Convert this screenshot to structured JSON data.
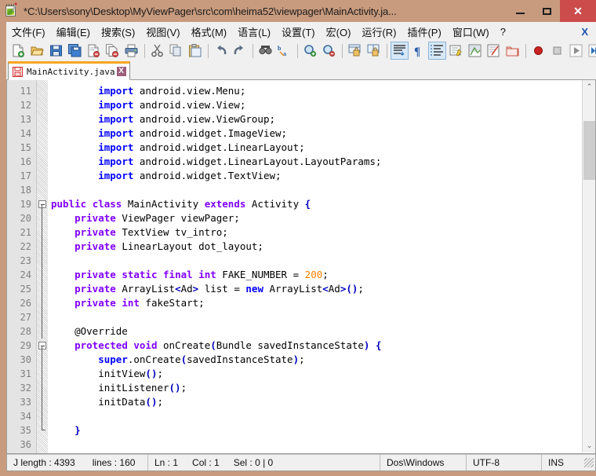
{
  "window": {
    "title": "*C:\\Users\\sony\\Desktop\\MyViewPager\\src\\com\\heima52\\viewpager\\MainActivity.ja...",
    "app_icon": "notepadpp-icon",
    "controls": {
      "minimize": "–",
      "maximize": "□",
      "close": "✕"
    }
  },
  "menubar": {
    "items": [
      {
        "label": "文件(F)"
      },
      {
        "label": "编辑(E)"
      },
      {
        "label": "搜索(S)"
      },
      {
        "label": "视图(V)"
      },
      {
        "label": "格式(M)"
      },
      {
        "label": "语言(L)"
      },
      {
        "label": "设置(T)"
      },
      {
        "label": "宏(O)"
      },
      {
        "label": "运行(R)"
      },
      {
        "label": "插件(P)"
      },
      {
        "label": "窗口(W)"
      },
      {
        "label": "?"
      }
    ],
    "close_document": "X"
  },
  "toolbar": {
    "buttons": [
      {
        "name": "new-file-icon",
        "tip": "新建"
      },
      {
        "name": "open-file-icon",
        "tip": "打开"
      },
      {
        "name": "save-icon",
        "tip": "保存"
      },
      {
        "name": "save-all-icon",
        "tip": "全部保存"
      },
      {
        "name": "close-file-icon",
        "tip": "关闭"
      },
      {
        "name": "close-all-files-icon",
        "tip": "全部关闭"
      },
      {
        "name": "print-icon",
        "tip": "打印"
      },
      {
        "name": "cut-icon",
        "tip": "剪切"
      },
      {
        "name": "copy-icon",
        "tip": "复制"
      },
      {
        "name": "paste-icon",
        "tip": "粘贴"
      },
      {
        "name": "undo-icon",
        "tip": "撤销"
      },
      {
        "name": "redo-icon",
        "tip": "重做"
      },
      {
        "name": "find-icon",
        "tip": "查找"
      },
      {
        "name": "replace-icon",
        "tip": "替换"
      },
      {
        "name": "zoom-in-icon",
        "tip": "放大"
      },
      {
        "name": "zoom-out-icon",
        "tip": "缩小"
      },
      {
        "name": "sync-vertical-icon",
        "tip": "同步垂直滚动"
      },
      {
        "name": "sync-horizontal-icon",
        "tip": "同步水平滚动"
      },
      {
        "name": "word-wrap-icon",
        "tip": "自动换行"
      },
      {
        "name": "show-all-chars-icon",
        "tip": "显示所有字符"
      },
      {
        "name": "indent-guide-icon",
        "tip": "显示缩进对齐线"
      },
      {
        "name": "user-language-icon",
        "tip": "用户自定义语言"
      },
      {
        "name": "doc-map-icon",
        "tip": "文档映射"
      },
      {
        "name": "function-list-icon",
        "tip": "函数列表"
      },
      {
        "name": "folder-workspace-icon",
        "tip": "文件夹"
      },
      {
        "name": "macro-record-icon",
        "tip": "开始录制"
      },
      {
        "name": "macro-stop-icon",
        "tip": "停止录制"
      },
      {
        "name": "macro-play-icon",
        "tip": "回放"
      },
      {
        "name": "macro-runmulti-icon",
        "tip": "多次运行"
      }
    ],
    "selected": [
      "word-wrap-icon",
      "indent-guide-icon"
    ]
  },
  "tabs": [
    {
      "label": "MainActivity.java",
      "icon": "red-save-icon",
      "close": "X",
      "active": true
    }
  ],
  "editor": {
    "first_line": 11,
    "lines": [
      {
        "n": 11,
        "fold": "none",
        "tokens": [
          {
            "t": "        ",
            "c": "pl"
          },
          {
            "t": "import",
            "c": "kw2"
          },
          {
            "t": " android.view.Menu;",
            "c": "pl"
          }
        ]
      },
      {
        "n": 12,
        "fold": "none",
        "tokens": [
          {
            "t": "        ",
            "c": "pl"
          },
          {
            "t": "import",
            "c": "kw2"
          },
          {
            "t": " android.view.View;",
            "c": "pl"
          }
        ]
      },
      {
        "n": 13,
        "fold": "none",
        "tokens": [
          {
            "t": "        ",
            "c": "pl"
          },
          {
            "t": "import",
            "c": "kw2"
          },
          {
            "t": " android.view.ViewGroup;",
            "c": "pl"
          }
        ]
      },
      {
        "n": 14,
        "fold": "none",
        "tokens": [
          {
            "t": "        ",
            "c": "pl"
          },
          {
            "t": "import",
            "c": "kw2"
          },
          {
            "t": " android.widget.ImageView;",
            "c": "pl"
          }
        ]
      },
      {
        "n": 15,
        "fold": "none",
        "tokens": [
          {
            "t": "        ",
            "c": "pl"
          },
          {
            "t": "import",
            "c": "kw2"
          },
          {
            "t": " android.widget.LinearLayout;",
            "c": "pl"
          }
        ]
      },
      {
        "n": 16,
        "fold": "none",
        "tokens": [
          {
            "t": "        ",
            "c": "pl"
          },
          {
            "t": "import",
            "c": "kw2"
          },
          {
            "t": " android.widget.LinearLayout.LayoutParams;",
            "c": "pl"
          }
        ]
      },
      {
        "n": 17,
        "fold": "none",
        "tokens": [
          {
            "t": "        ",
            "c": "pl"
          },
          {
            "t": "import",
            "c": "kw2"
          },
          {
            "t": " android.widget.TextView;",
            "c": "pl"
          }
        ]
      },
      {
        "n": 18,
        "fold": "none",
        "tokens": []
      },
      {
        "n": 19,
        "fold": "open",
        "tokens": [
          {
            "t": "",
            "c": "pl"
          },
          {
            "t": "public",
            "c": "kw"
          },
          {
            "t": " ",
            "c": "pl"
          },
          {
            "t": "class",
            "c": "kw"
          },
          {
            "t": " MainActivity ",
            "c": "pl"
          },
          {
            "t": "extends",
            "c": "kw"
          },
          {
            "t": " Activity ",
            "c": "pl"
          },
          {
            "t": "{",
            "c": "op"
          }
        ]
      },
      {
        "n": 20,
        "fold": "line",
        "tokens": [
          {
            "t": "    ",
            "c": "pl"
          },
          {
            "t": "private",
            "c": "kw"
          },
          {
            "t": " ViewPager viewPager;",
            "c": "pl"
          }
        ]
      },
      {
        "n": 21,
        "fold": "line",
        "tokens": [
          {
            "t": "    ",
            "c": "pl"
          },
          {
            "t": "private",
            "c": "kw"
          },
          {
            "t": " TextView tv_intro;",
            "c": "pl"
          }
        ]
      },
      {
        "n": 22,
        "fold": "line",
        "tokens": [
          {
            "t": "    ",
            "c": "pl"
          },
          {
            "t": "private",
            "c": "kw"
          },
          {
            "t": " LinearLayout dot_layout;",
            "c": "pl"
          }
        ]
      },
      {
        "n": 23,
        "fold": "line",
        "tokens": []
      },
      {
        "n": 24,
        "fold": "line",
        "tokens": [
          {
            "t": "    ",
            "c": "pl"
          },
          {
            "t": "private",
            "c": "kw"
          },
          {
            "t": " ",
            "c": "pl"
          },
          {
            "t": "static",
            "c": "kw"
          },
          {
            "t": " ",
            "c": "pl"
          },
          {
            "t": "final",
            "c": "kw"
          },
          {
            "t": " ",
            "c": "pl"
          },
          {
            "t": "int",
            "c": "kw"
          },
          {
            "t": " FAKE_NUMBER ",
            "c": "pl"
          },
          {
            "t": "=",
            "c": "pl"
          },
          {
            "t": " ",
            "c": "pl"
          },
          {
            "t": "200",
            "c": "num"
          },
          {
            "t": ";",
            "c": "pl"
          }
        ]
      },
      {
        "n": 25,
        "fold": "line",
        "tokens": [
          {
            "t": "    ",
            "c": "pl"
          },
          {
            "t": "private",
            "c": "kw"
          },
          {
            "t": " ArrayList",
            "c": "pl"
          },
          {
            "t": "<",
            "c": "op"
          },
          {
            "t": "Ad",
            "c": "pl"
          },
          {
            "t": ">",
            "c": "op"
          },
          {
            "t": " list ",
            "c": "pl"
          },
          {
            "t": "=",
            "c": "pl"
          },
          {
            "t": " ",
            "c": "pl"
          },
          {
            "t": "new",
            "c": "kw2"
          },
          {
            "t": " ArrayList",
            "c": "pl"
          },
          {
            "t": "<",
            "c": "op"
          },
          {
            "t": "Ad",
            "c": "pl"
          },
          {
            "t": ">()",
            "c": "op"
          },
          {
            "t": ";",
            "c": "pl"
          }
        ]
      },
      {
        "n": 26,
        "fold": "line",
        "tokens": [
          {
            "t": "    ",
            "c": "pl"
          },
          {
            "t": "private",
            "c": "kw"
          },
          {
            "t": " ",
            "c": "pl"
          },
          {
            "t": "int",
            "c": "kw"
          },
          {
            "t": " fakeStart;",
            "c": "pl"
          }
        ]
      },
      {
        "n": 27,
        "fold": "line",
        "tokens": []
      },
      {
        "n": 28,
        "fold": "line",
        "tokens": [
          {
            "t": "    @Override",
            "c": "pl"
          }
        ]
      },
      {
        "n": 29,
        "fold": "open",
        "tokens": [
          {
            "t": "    ",
            "c": "pl"
          },
          {
            "t": "protected",
            "c": "kw"
          },
          {
            "t": " ",
            "c": "pl"
          },
          {
            "t": "void",
            "c": "kw"
          },
          {
            "t": " onCreate",
            "c": "pl"
          },
          {
            "t": "(",
            "c": "op"
          },
          {
            "t": "Bundle savedInstanceState",
            "c": "pl"
          },
          {
            "t": ")",
            "c": "op"
          },
          {
            "t": " ",
            "c": "pl"
          },
          {
            "t": "{",
            "c": "op"
          }
        ]
      },
      {
        "n": 30,
        "fold": "line",
        "tokens": [
          {
            "t": "        ",
            "c": "pl"
          },
          {
            "t": "super",
            "c": "kw2"
          },
          {
            "t": ".onCreate",
            "c": "pl"
          },
          {
            "t": "(",
            "c": "op"
          },
          {
            "t": "savedInstanceState",
            "c": "pl"
          },
          {
            "t": ")",
            "c": "op"
          },
          {
            "t": ";",
            "c": "pl"
          }
        ]
      },
      {
        "n": 31,
        "fold": "line",
        "tokens": [
          {
            "t": "        initView",
            "c": "pl"
          },
          {
            "t": "()",
            "c": "op"
          },
          {
            "t": ";",
            "c": "pl"
          }
        ]
      },
      {
        "n": 32,
        "fold": "line",
        "tokens": [
          {
            "t": "        initListener",
            "c": "pl"
          },
          {
            "t": "()",
            "c": "op"
          },
          {
            "t": ";",
            "c": "pl"
          }
        ]
      },
      {
        "n": 33,
        "fold": "line",
        "tokens": [
          {
            "t": "        initData",
            "c": "pl"
          },
          {
            "t": "()",
            "c": "op"
          },
          {
            "t": ";",
            "c": "pl"
          }
        ]
      },
      {
        "n": 34,
        "fold": "line",
        "tokens": []
      },
      {
        "n": 35,
        "fold": "end",
        "tokens": [
          {
            "t": "    ",
            "c": "pl"
          },
          {
            "t": "}",
            "c": "op"
          }
        ]
      },
      {
        "n": 36,
        "fold": "none",
        "tokens": []
      }
    ]
  },
  "scrollbar": {
    "up_arrow": "⌃",
    "down_arrow": "⌄",
    "thumb_top_pct": 8,
    "thumb_height_pct": 17
  },
  "statusbar": {
    "doc_length_label": "J length : 4393",
    "lines_label": "lines : 160",
    "ln": "Ln : 1",
    "col": "Col : 1",
    "sel": "Sel : 0 | 0",
    "eol": "Dos\\Windows",
    "encoding": "UTF-8",
    "insert_mode": "INS"
  },
  "colors": {
    "frame": "#c89b7e",
    "chrome": "#f0f0f0",
    "close_button": "#cc4c4c",
    "tab_accent": "#f5a623",
    "keyword": "#8000ff",
    "keyword_blue": "#0000ff",
    "number": "#ff8000",
    "operator": "#0000c0",
    "gutter_bg": "#e4e4e4",
    "gutter_fg": "#808080"
  }
}
